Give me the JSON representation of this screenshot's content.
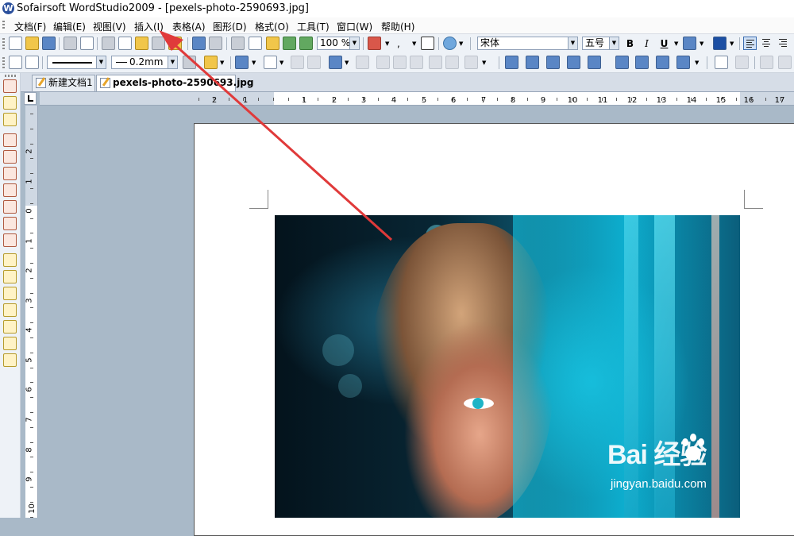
{
  "window": {
    "title": "Sofairsoft WordStudio2009 - [pexels-photo-2590693.jpg]"
  },
  "menubar": {
    "items": [
      "文档(F)",
      "编辑(E)",
      "视图(V)",
      "插入(I)",
      "表格(A)",
      "图形(D)",
      "格式(O)",
      "工具(T)",
      "窗口(W)",
      "帮助(H)"
    ]
  },
  "toolbar1": {
    "zoom": "100 %",
    "font_name": "宋体",
    "font_size": "五号",
    "bold": "B",
    "italic": "I",
    "underline": "U"
  },
  "toolbar2": {
    "line_width": "0.2mm"
  },
  "tabs": [
    {
      "label": "新建文档1",
      "active": false
    },
    {
      "label": "pexels-photo-2590693.jpg",
      "active": true
    }
  ],
  "ruler": {
    "h_ticks": [
      "2",
      "1",
      "1",
      "2",
      "3",
      "4",
      "5",
      "6",
      "7",
      "8",
      "9",
      "10",
      "11",
      "12",
      "13",
      "14",
      "15",
      "16",
      "17"
    ],
    "v_ticks": [
      "2",
      "1",
      "0",
      "1",
      "2",
      "3",
      "4",
      "5",
      "6",
      "7",
      "8",
      "9",
      "10"
    ]
  },
  "watermark": {
    "brand": "Bai  经验",
    "url": "jingyan.baidu.com"
  },
  "colors": {
    "annotation_arrow": "#e03a3a",
    "workspace": "#a9b9c8"
  }
}
